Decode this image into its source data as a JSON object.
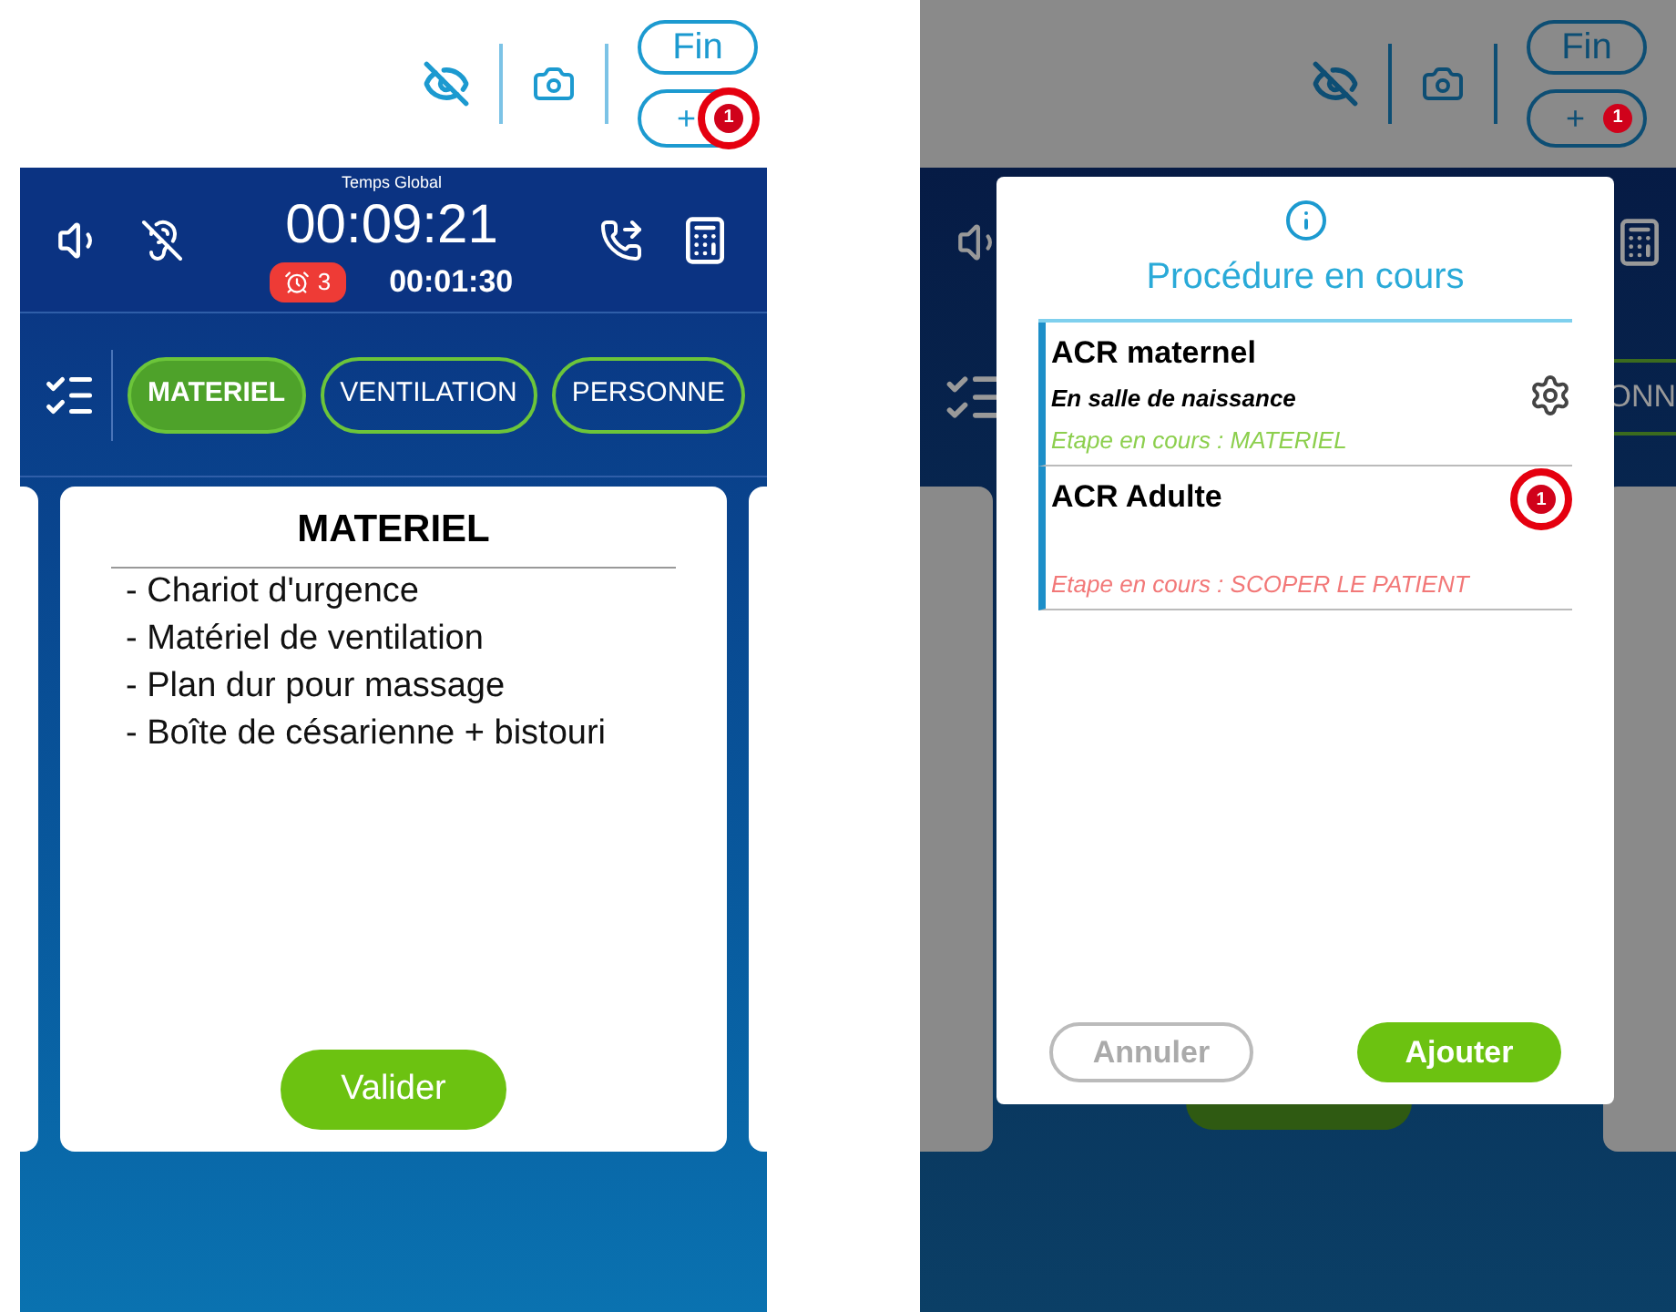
{
  "main_screen": {
    "toolbar": {
      "end_button": "Fin",
      "add_button": {
        "label": "+",
        "badge": "1",
        "annotated": true
      }
    },
    "header": {
      "caption": "Temps Global",
      "global_time": "00:09:21",
      "alarm_count": "3",
      "step_time": "00:01:30"
    },
    "tabs": [
      {
        "label": "MATERIEL",
        "selected": true
      },
      {
        "label": "VENTILATION",
        "selected": false
      },
      {
        "label": "PERSONNE",
        "selected": false
      }
    ],
    "card": {
      "title": "MATERIEL",
      "items": [
        "- Chariot d'urgence",
        "- Matériel de ventilation",
        "- Plan dur pour massage",
        "- Boîte de césarienne + bistouri"
      ],
      "button": "Valider"
    }
  },
  "dialog_screen": {
    "toolbar": {
      "end_button": "Fin",
      "add_button": {
        "label": "+",
        "badge": "1"
      }
    },
    "tab_fragment": "ONN",
    "dialog": {
      "title": "Procédure en cours",
      "procedures": [
        {
          "name": "ACR maternel",
          "location": "En salle de naissance",
          "step": "Etape en cours : MATERIEL",
          "color": "#8ccf4d",
          "settings": true
        },
        {
          "name": "ACR Adulte",
          "badge": "1",
          "annotated": true,
          "step": "Etape en cours : SCOPER LE PATIENT",
          "color": "#f27878",
          "settings": false
        }
      ],
      "buttons": [
        {
          "label": "Annuler",
          "kind": "secondary"
        },
        {
          "label": "Ajouter",
          "kind": "primary"
        }
      ]
    }
  }
}
